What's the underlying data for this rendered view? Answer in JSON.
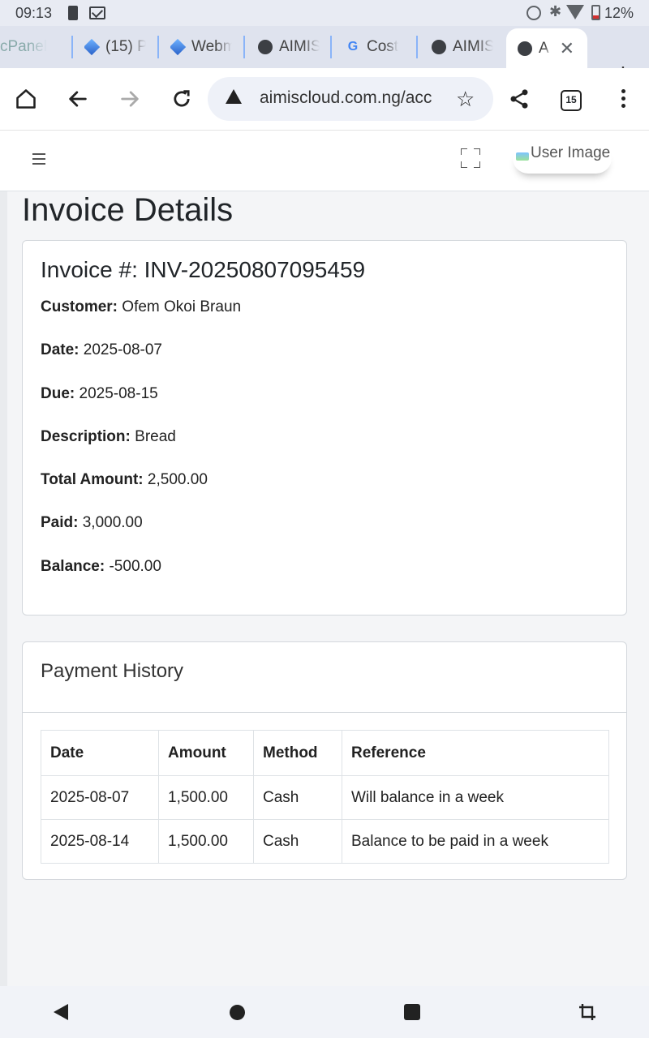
{
  "status_bar": {
    "time": "09:13",
    "battery": "12%"
  },
  "tabs": [
    {
      "label": "cPanel",
      "icon": "cpanel-icon"
    },
    {
      "label": "(15) P",
      "icon": "cube-icon"
    },
    {
      "label": "Webm",
      "icon": "cube-icon"
    },
    {
      "label": "AIMIS",
      "icon": "globe-icon"
    },
    {
      "label": "Cost",
      "icon": "google-icon"
    },
    {
      "label": "AIMIS",
      "icon": "globe-icon"
    },
    {
      "label": "AIM",
      "icon": "globe-icon",
      "active": true
    }
  ],
  "browser": {
    "url": "aimiscloud.com.ng/acc",
    "tab_count": "15"
  },
  "app_header": {
    "user_image_alt": "User Image"
  },
  "page": {
    "title": "Invoice Details"
  },
  "invoice": {
    "heading": "Invoice #: INV-20250807095459",
    "fields": [
      {
        "label": "Customer:",
        "value": "Ofem Okoi Braun"
      },
      {
        "label": "Date:",
        "value": "2025-08-07"
      },
      {
        "label": "Due:",
        "value": "2025-08-15"
      },
      {
        "label": "Description:",
        "value": "Bread"
      },
      {
        "label": "Total Amount:",
        "value": "2,500.00"
      },
      {
        "label": "Paid:",
        "value": "3,000.00"
      },
      {
        "label": "Balance:",
        "value": "-500.00"
      }
    ]
  },
  "payments": {
    "title": "Payment History",
    "columns": [
      "Date",
      "Amount",
      "Method",
      "Reference"
    ],
    "rows": [
      [
        "2025-08-07",
        "1,500.00",
        "Cash",
        "Will balance in a week"
      ],
      [
        "2025-08-14",
        "1,500.00",
        "Cash",
        "Balance to be paid in a week"
      ]
    ]
  }
}
